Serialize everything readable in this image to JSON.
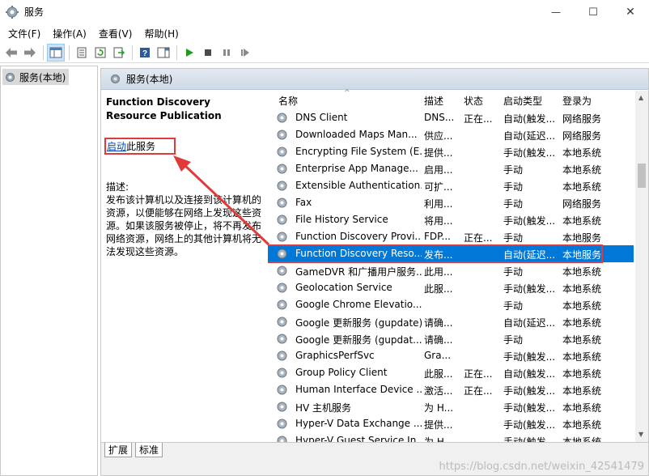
{
  "window": {
    "title": "服务",
    "minimize_glyph": "—",
    "maximize_glyph": "☐",
    "close_glyph": "✕"
  },
  "menu": [
    "文件(F)",
    "操作(A)",
    "查看(V)",
    "帮助(H)"
  ],
  "tree": {
    "root_label": "服务(本地)"
  },
  "main": {
    "header": "服务(本地)",
    "service_title": "Function Discovery Resource Publication",
    "start_link": "启动",
    "start_suffix": "此服务",
    "desc_label": "描述:",
    "desc_text": "发布该计算机以及连接到该计算机的资源，以便能够在网络上发现这些资源。如果该服务被停止，将不再发布网络资源，网络上的其他计算机将无法发现这些资源。"
  },
  "list": {
    "columns": [
      "名称",
      "描述",
      "状态",
      "启动类型",
      "登录为"
    ],
    "rows": [
      [
        "DNS Client",
        "DNS...",
        "正在...",
        "自动(触发...",
        "网络服务"
      ],
      [
        "Downloaded Maps Man...",
        "供应...",
        "",
        "自动(延迟...",
        "网络服务"
      ],
      [
        "Encrypting File System (E...",
        "提供...",
        "",
        "手动(触发...",
        "本地系统"
      ],
      [
        "Enterprise App Manage...",
        "启用...",
        "",
        "手动",
        "本地系统"
      ],
      [
        "Extensible Authentication...",
        "可扩...",
        "",
        "手动",
        "本地系统"
      ],
      [
        "Fax",
        "利用...",
        "",
        "手动",
        "网络服务"
      ],
      [
        "File History Service",
        "将用...",
        "",
        "手动(触发...",
        "本地系统"
      ],
      [
        "Function Discovery Provi...",
        "FDP...",
        "正在...",
        "手动",
        "本地服务"
      ],
      [
        "Function Discovery Reso...",
        "发布...",
        "",
        "自动(延迟...",
        "本地服务"
      ],
      [
        "GameDVR 和广播用户服务...",
        "此用...",
        "",
        "手动",
        "本地系统"
      ],
      [
        "Geolocation Service",
        "此服...",
        "",
        "手动(触发...",
        "本地系统"
      ],
      [
        "Google Chrome Elevatio...",
        "",
        "",
        "手动",
        "本地系统"
      ],
      [
        "Google 更新服务 (gupdate)",
        "请确...",
        "",
        "自动(延迟...",
        "本地系统"
      ],
      [
        "Google 更新服务 (gupdat...",
        "请确...",
        "",
        "手动",
        "本地系统"
      ],
      [
        "GraphicsPerfSvc",
        "Gra...",
        "",
        "手动(触发...",
        "本地系统"
      ],
      [
        "Group Policy Client",
        "此服...",
        "正在...",
        "自动(触发...",
        "本地系统"
      ],
      [
        "Human Interface Device ...",
        "激活...",
        "正在...",
        "手动(触发...",
        "本地系统"
      ],
      [
        "HV 主机服务",
        "为 H...",
        "",
        "手动(触发...",
        "本地系统"
      ],
      [
        "Hyper-V Data Exchange ...",
        "提供...",
        "",
        "手动(触发...",
        "本地系统"
      ],
      [
        "Hyper-V Guest Service In...",
        "为 H...",
        "",
        "手动(触发...",
        "本地系统"
      ]
    ],
    "selected_index": 8
  },
  "tabs": [
    "扩展",
    "标准"
  ],
  "watermark": "https://blog.csdn.net/weixin_42541479",
  "colors": {
    "selection": "#0078d7",
    "highlight_box": "#e03b3b",
    "link": "#0645ad"
  }
}
